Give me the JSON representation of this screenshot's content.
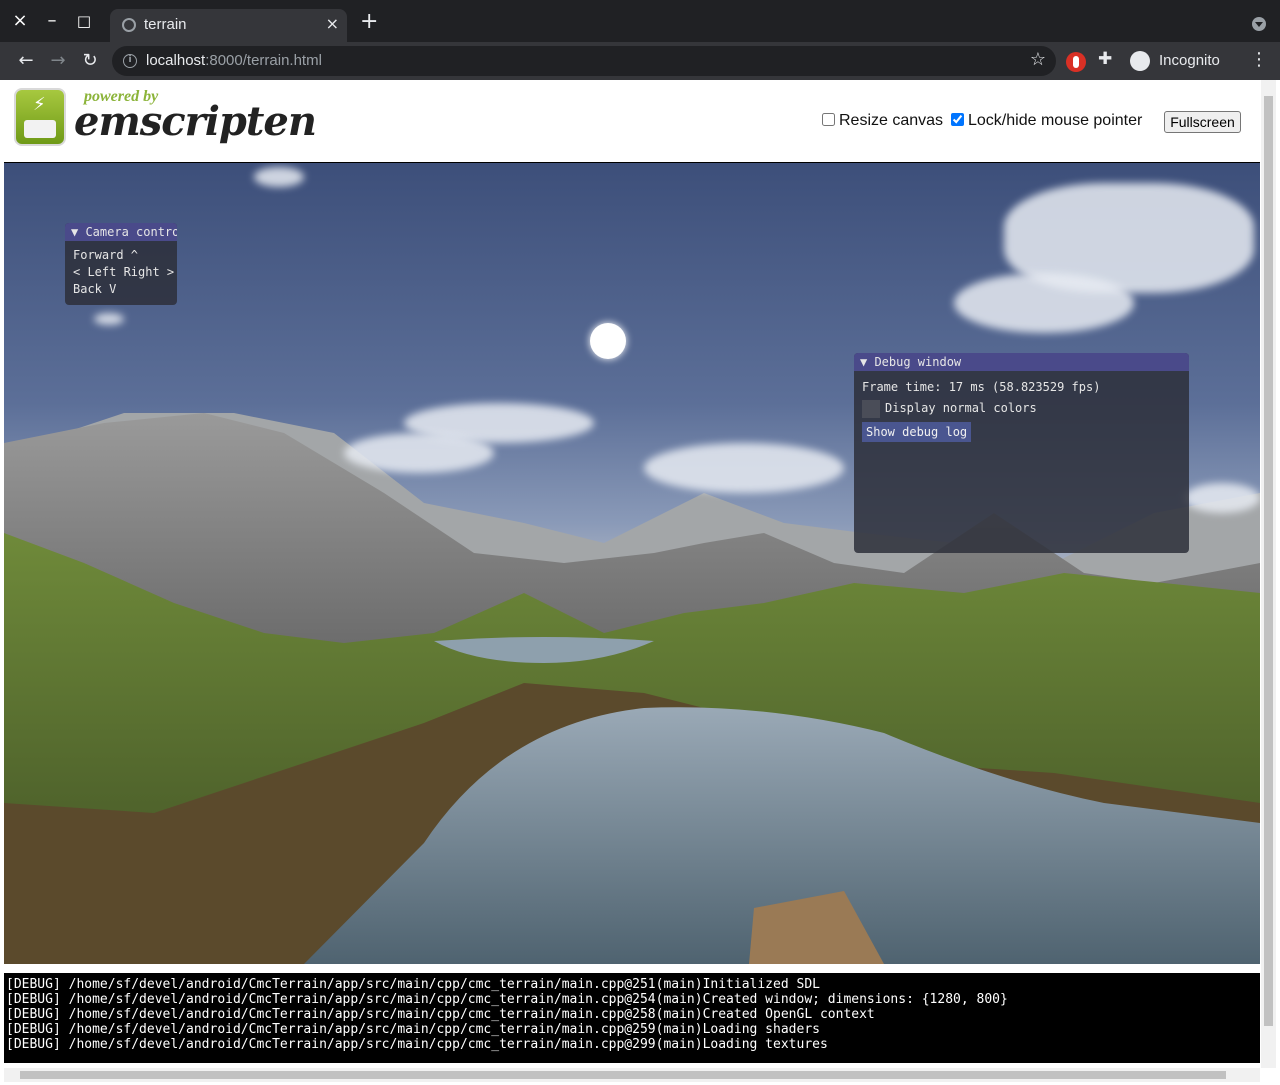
{
  "browser": {
    "tab_title": "terrain",
    "url_host": "localhost",
    "url_path": ":8000/terrain.html",
    "profile_label": "Incognito"
  },
  "header": {
    "logo_tagline": "powered by",
    "logo_name": "emscripten",
    "resize_canvas_label": "Resize canvas",
    "resize_canvas_checked": false,
    "lock_pointer_label": "Lock/hide mouse pointer",
    "lock_pointer_checked": true,
    "fullscreen_label": "Fullscreen"
  },
  "camera_window": {
    "title": "▼ Camera contro",
    "lines": [
      "Forward ^",
      "< Left Right >",
      "Back V"
    ]
  },
  "debug_window": {
    "title": "▼ Debug window",
    "frame_time": "Frame time: 17 ms (58.823529 fps)",
    "normal_colors_label": "Display normal colors",
    "show_log_label": "Show debug log"
  },
  "console": [
    "[DEBUG] /home/sf/devel/android/CmcTerrain/app/src/main/cpp/cmc_terrain/main.cpp@251(main)Initialized SDL",
    "[DEBUG] /home/sf/devel/android/CmcTerrain/app/src/main/cpp/cmc_terrain/main.cpp@254(main)Created window; dimensions: {1280, 800}",
    "[DEBUG] /home/sf/devel/android/CmcTerrain/app/src/main/cpp/cmc_terrain/main.cpp@258(main)Created OpenGL context",
    "[DEBUG] /home/sf/devel/android/CmcTerrain/app/src/main/cpp/cmc_terrain/main.cpp@259(main)Loading shaders",
    "[DEBUG] /home/sf/devel/android/CmcTerrain/app/src/main/cpp/cmc_terrain/main.cpp@299(main)Loading textures"
  ],
  "icons": {
    "close": "×",
    "minimize": "–",
    "maximize": "□",
    "tab_close": "×",
    "new_tab": "+",
    "back": "←",
    "forward": "→",
    "reload": "↻",
    "star": "☆",
    "puzzle": "✚",
    "kebab": "⋮",
    "bolt": "⚡"
  }
}
